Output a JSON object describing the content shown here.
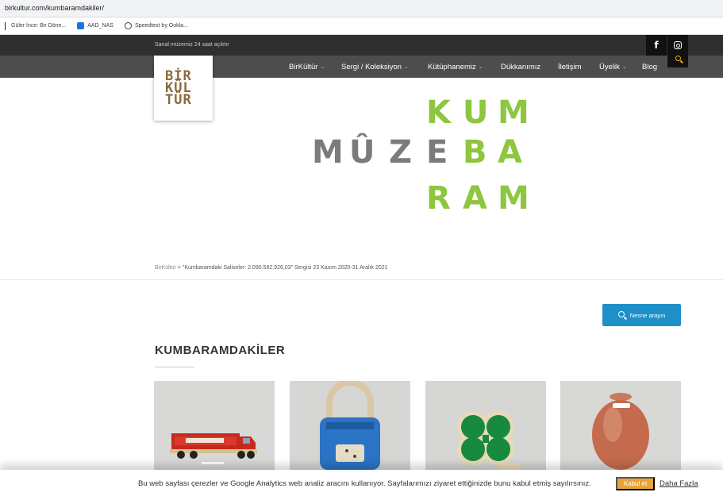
{
  "browser": {
    "url": "birkultur.com/kumbaramdakiler/",
    "bookmarks": [
      {
        "label": "Güler İnce: Bir Döne...",
        "icon": "bookmark-icon"
      },
      {
        "label": "AAD_NAS",
        "icon": "nas-icon"
      },
      {
        "label": "Speedtest by Ookla...",
        "icon": "speedtest-icon"
      }
    ]
  },
  "topbar": {
    "tagline": "Sanal müzemiz 24 saat açıktır",
    "facebook_glyph": "f"
  },
  "logo": {
    "lines": [
      "BİR",
      "KÜL",
      "TÜR"
    ]
  },
  "nav": {
    "items": [
      {
        "label": "BirKültür",
        "dropdown": true
      },
      {
        "label": "Sergi / Koleksiyon",
        "dropdown": true
      },
      {
        "label": "Kütüphanemiz",
        "dropdown": true
      },
      {
        "label": "Dükkanımız",
        "dropdown": false
      },
      {
        "label": "İletişim",
        "dropdown": false
      },
      {
        "label": "Üyelik",
        "dropdown": true
      },
      {
        "label": "Blog",
        "dropdown": false
      }
    ],
    "chevron": "⌄"
  },
  "hero": {
    "letters": [
      "M",
      "Û",
      "Z",
      "E",
      "K",
      "U",
      "M",
      "B",
      "A",
      "R",
      "A",
      "M"
    ],
    "gray_color": "#7b7b7b",
    "green_color": "#8dc63f"
  },
  "breadcrumb": {
    "home": "BirKültür",
    "separator": ">",
    "current": "\"Kumbaramdaki Saliseler: 2.090.582.926,03\" Sergisi 23 Kasım 2020-31 Aralık 2021"
  },
  "search_button": {
    "label": "Nesne arayın"
  },
  "section": {
    "title": "KUMBARAMDAKİLER"
  },
  "cookie": {
    "message": "Bu web sayfası çerezler ve Google Analytics web analiz aracını kullanıyor. Sayfalarımızı ziyaret ettiğinizde bunu kabul etmiş sayılırsınız.",
    "accept": "Kabul et",
    "more": "Daha Fazla"
  },
  "colors": {
    "accent_blue": "#1e90c8",
    "cookie_button": "#e8a43a",
    "logo_brown": "#8c6a3c",
    "nav_bg": "#4d4d4d",
    "topbar_bg": "#2f2f2f"
  }
}
